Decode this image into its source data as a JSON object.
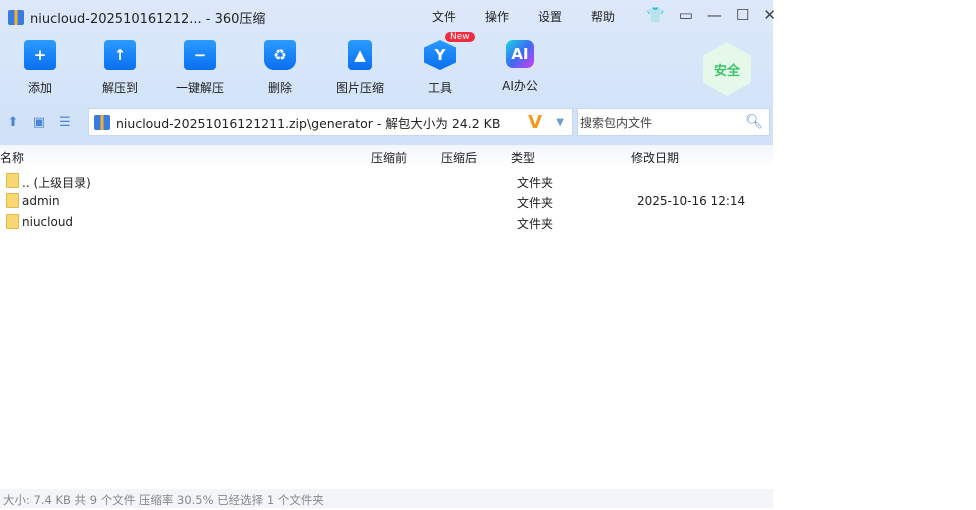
{
  "title": "niucloud-202510161212... - 360压缩",
  "menu": [
    "文件",
    "操作",
    "设置",
    "帮助"
  ],
  "toolbar": [
    {
      "label": "添加",
      "icon": "+"
    },
    {
      "label": "解压到",
      "icon": "↑"
    },
    {
      "label": "一键解压",
      "icon": "−"
    },
    {
      "label": "删除",
      "icon": "♻"
    },
    {
      "label": "图片压缩",
      "icon": "▲"
    },
    {
      "label": "工具",
      "icon": "Y",
      "badge": "New"
    },
    {
      "label": "AI办公",
      "icon": "AI"
    }
  ],
  "safe_badge": "安全",
  "address": "niucloud-20251016121211.zip\\generator - 解包大小为 24.2 KB",
  "search_placeholder": "搜索包内文件",
  "columns": [
    "名称",
    "压缩前",
    "压缩后",
    "类型",
    "修改日期"
  ],
  "rows": [
    {
      "name": ".. (上级目录)",
      "type": "文件夹",
      "date": ""
    },
    {
      "name": "admin",
      "type": "文件夹",
      "date": "2025-10-16 12:14"
    },
    {
      "name": "niucloud",
      "type": "文件夹",
      "date": ""
    }
  ],
  "status": "大小: 7.4 KB 共 9 个文件 压缩率 30.5% 已经选择 1 个文件夹"
}
